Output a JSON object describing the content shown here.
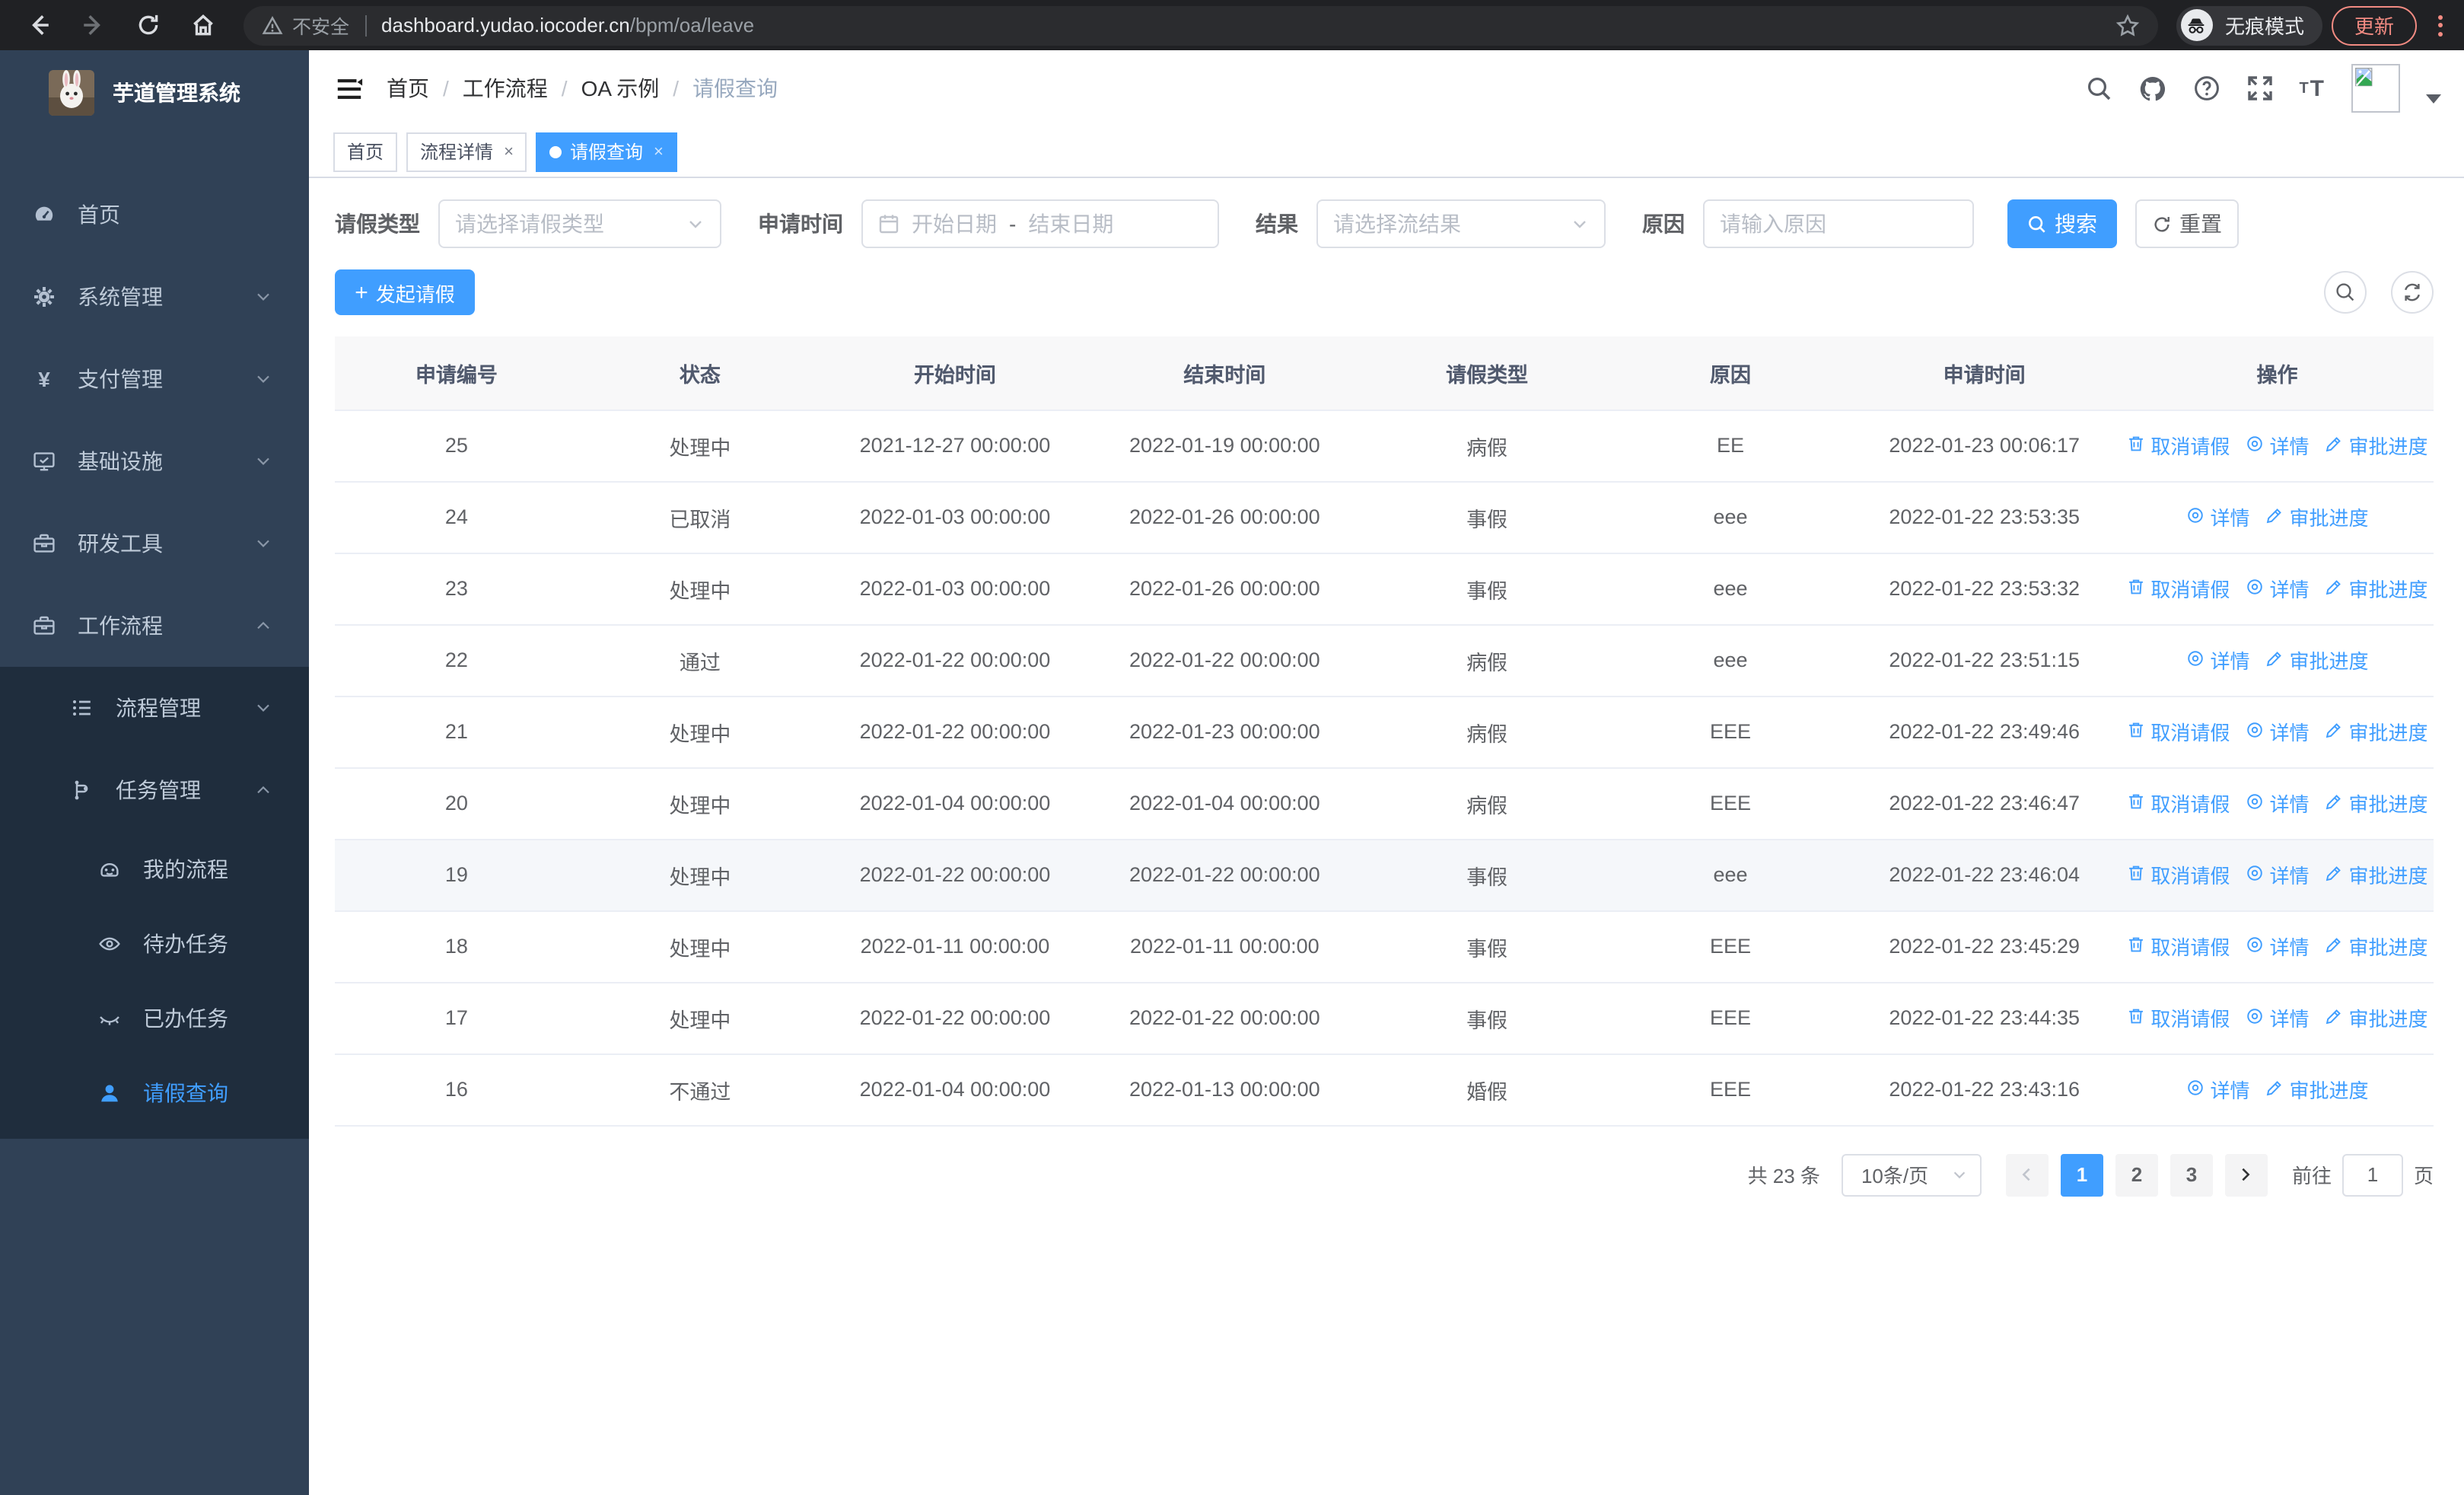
{
  "browser": {
    "security_label": "不安全",
    "url_host": "dashboard.yudao.iocoder.cn",
    "url_path": "/bpm/oa/leave",
    "incognito_label": "无痕模式",
    "update_label": "更新"
  },
  "sidebar": {
    "app_title": "芋道管理系统",
    "menu": [
      {
        "label": "首页",
        "icon": "dashboard-icon",
        "level": 1
      },
      {
        "label": "系统管理",
        "icon": "gear-icon",
        "level": 1,
        "chevron": "down"
      },
      {
        "label": "支付管理",
        "icon": "yen-icon",
        "level": 1,
        "chevron": "down"
      },
      {
        "label": "基础设施",
        "icon": "monitor-icon",
        "level": 1,
        "chevron": "down"
      },
      {
        "label": "研发工具",
        "icon": "toolbox-icon",
        "level": 1,
        "chevron": "down"
      },
      {
        "label": "工作流程",
        "icon": "briefcase-icon",
        "level": 1,
        "chevron": "up",
        "children": [
          {
            "label": "流程管理",
            "icon": "list-icon",
            "level": 2,
            "chevron": "down"
          },
          {
            "label": "任务管理",
            "icon": "flow-icon",
            "level": 2,
            "chevron": "up",
            "children": [
              {
                "label": "我的流程",
                "icon": "robot-icon",
                "level": 3
              },
              {
                "label": "待办任务",
                "icon": "eye-icon",
                "level": 3
              },
              {
                "label": "已办任务",
                "icon": "eye-closed-icon",
                "level": 3
              },
              {
                "label": "请假查询",
                "icon": "user-icon",
                "level": 3,
                "active": true
              }
            ]
          }
        ]
      }
    ]
  },
  "header": {
    "breadcrumb": [
      "首页",
      "工作流程",
      "OA 示例",
      "请假查询"
    ]
  },
  "tabs": [
    {
      "label": "首页",
      "closable": false,
      "active": false
    },
    {
      "label": "流程详情",
      "closable": true,
      "active": false
    },
    {
      "label": "请假查询",
      "closable": true,
      "active": true
    }
  ],
  "filters": {
    "leave_type_label": "请假类型",
    "leave_type_placeholder": "请选择请假类型",
    "apply_time_label": "申请时间",
    "start_date_placeholder": "开始日期",
    "range_separator": "-",
    "end_date_placeholder": "结束日期",
    "result_label": "结果",
    "result_placeholder": "请选择流结果",
    "reason_label": "原因",
    "reason_placeholder": "请输入原因",
    "search_label": "搜索",
    "reset_label": "重置"
  },
  "toolbar": {
    "create_label": "发起请假"
  },
  "table": {
    "columns": [
      "申请编号",
      "状态",
      "开始时间",
      "结束时间",
      "请假类型",
      "原因",
      "申请时间",
      "操作"
    ],
    "action_defs": {
      "cancel": {
        "label": "取消请假",
        "icon": "trash-icon"
      },
      "detail": {
        "label": "详情",
        "icon": "view-icon"
      },
      "progress": {
        "label": "审批进度",
        "icon": "edit-icon"
      }
    },
    "rows": [
      {
        "id": "25",
        "status": "处理中",
        "start_time": "2021-12-27 00:00:00",
        "end_time": "2022-01-19 00:00:00",
        "leave_type": "病假",
        "reason": "EE",
        "apply_time": "2022-01-23 00:06:17",
        "actions": [
          "cancel",
          "detail",
          "progress"
        ],
        "highlighted": false
      },
      {
        "id": "24",
        "status": "已取消",
        "start_time": "2022-01-03 00:00:00",
        "end_time": "2022-01-26 00:00:00",
        "leave_type": "事假",
        "reason": "eee",
        "apply_time": "2022-01-22 23:53:35",
        "actions": [
          "detail",
          "progress"
        ],
        "highlighted": false
      },
      {
        "id": "23",
        "status": "处理中",
        "start_time": "2022-01-03 00:00:00",
        "end_time": "2022-01-26 00:00:00",
        "leave_type": "事假",
        "reason": "eee",
        "apply_time": "2022-01-22 23:53:32",
        "actions": [
          "cancel",
          "detail",
          "progress"
        ],
        "highlighted": false
      },
      {
        "id": "22",
        "status": "通过",
        "start_time": "2022-01-22 00:00:00",
        "end_time": "2022-01-22 00:00:00",
        "leave_type": "病假",
        "reason": "eee",
        "apply_time": "2022-01-22 23:51:15",
        "actions": [
          "detail",
          "progress"
        ],
        "highlighted": false
      },
      {
        "id": "21",
        "status": "处理中",
        "start_time": "2022-01-22 00:00:00",
        "end_time": "2022-01-23 00:00:00",
        "leave_type": "病假",
        "reason": "EEE",
        "apply_time": "2022-01-22 23:49:46",
        "actions": [
          "cancel",
          "detail",
          "progress"
        ],
        "highlighted": false
      },
      {
        "id": "20",
        "status": "处理中",
        "start_time": "2022-01-04 00:00:00",
        "end_time": "2022-01-04 00:00:00",
        "leave_type": "病假",
        "reason": "EEE",
        "apply_time": "2022-01-22 23:46:47",
        "actions": [
          "cancel",
          "detail",
          "progress"
        ],
        "highlighted": false
      },
      {
        "id": "19",
        "status": "处理中",
        "start_time": "2022-01-22 00:00:00",
        "end_time": "2022-01-22 00:00:00",
        "leave_type": "事假",
        "reason": "eee",
        "apply_time": "2022-01-22 23:46:04",
        "actions": [
          "cancel",
          "detail",
          "progress"
        ],
        "highlighted": true
      },
      {
        "id": "18",
        "status": "处理中",
        "start_time": "2022-01-11 00:00:00",
        "end_time": "2022-01-11 00:00:00",
        "leave_type": "事假",
        "reason": "EEE",
        "apply_time": "2022-01-22 23:45:29",
        "actions": [
          "cancel",
          "detail",
          "progress"
        ],
        "highlighted": false
      },
      {
        "id": "17",
        "status": "处理中",
        "start_time": "2022-01-22 00:00:00",
        "end_time": "2022-01-22 00:00:00",
        "leave_type": "事假",
        "reason": "EEE",
        "apply_time": "2022-01-22 23:44:35",
        "actions": [
          "cancel",
          "detail",
          "progress"
        ],
        "highlighted": false
      },
      {
        "id": "16",
        "status": "不通过",
        "start_time": "2022-01-04 00:00:00",
        "end_time": "2022-01-13 00:00:00",
        "leave_type": "婚假",
        "reason": "EEE",
        "apply_time": "2022-01-22 23:43:16",
        "actions": [
          "detail",
          "progress"
        ],
        "highlighted": false
      }
    ]
  },
  "pagination": {
    "total_label": "共 23 条",
    "page_size": "10条/页",
    "pages": [
      "1",
      "2",
      "3"
    ],
    "active_page": "1",
    "goto_label": "前往",
    "goto_value": "1",
    "goto_suffix": "页"
  },
  "colors": {
    "accent": "#409eff",
    "sidebar_bg": "#304156",
    "submenu_bg": "#1f2d3d",
    "chrome_bg": "#202124",
    "update_badge": "#f28b82",
    "table_header_bg": "#f8f8f9"
  }
}
